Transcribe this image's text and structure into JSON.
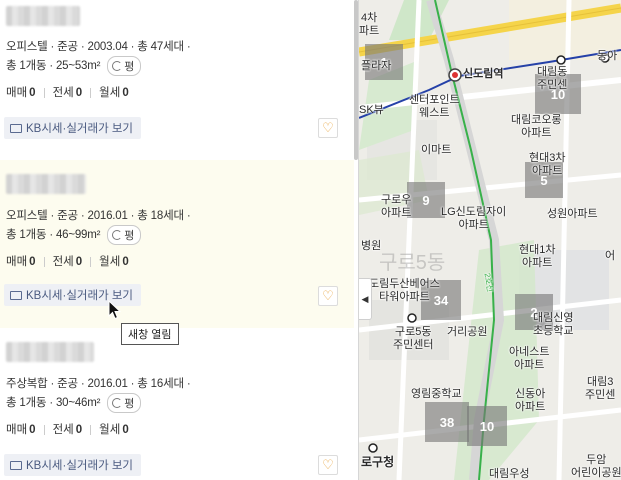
{
  "listings": [
    {
      "meta": "오피스텔 · 준공 · 2003.04 · 총 47세대 ·",
      "area": "총 1개동 · 25~53m²",
      "pyeong_label": "평",
      "prices": [
        {
          "label": "매매",
          "value": "0"
        },
        {
          "label": "전세",
          "value": "0"
        },
        {
          "label": "월세",
          "value": "0"
        }
      ],
      "kb_button": "KB시세·실거래가 보기"
    },
    {
      "meta": "오피스텔 · 준공 · 2016.01 · 총 18세대 ·",
      "area": "총 1개동 · 46~99m²",
      "pyeong_label": "평",
      "prices": [
        {
          "label": "매매",
          "value": "0"
        },
        {
          "label": "전세",
          "value": "0"
        },
        {
          "label": "월세",
          "value": "0"
        }
      ],
      "kb_button": "KB시세·실거래가 보기"
    },
    {
      "meta": "주상복합 · 준공 · 2016.01 · 총 16세대 ·",
      "area": "총 1개동 · 30~46m²",
      "pyeong_label": "평",
      "prices": [
        {
          "label": "매매",
          "value": "0"
        },
        {
          "label": "전세",
          "value": "0"
        },
        {
          "label": "월세",
          "value": "0"
        }
      ],
      "kb_button": "KB시세·실거래가 보기"
    }
  ],
  "tooltip": "새창 열림",
  "icons": {
    "heart": "heart-icon",
    "refresh": "refresh-icon",
    "kb": "kb-monitor-icon",
    "cursor": "mouse-cursor-icon",
    "collapse": "chevron-left-icon"
  },
  "colors": {
    "highlight_bg": "#fdfcef",
    "kb_button_bg": "#eef0f5",
    "heart": "#e8a33c",
    "line2": "#38b14a",
    "line1": "#2541a8",
    "yellow_road": "#f5d44a"
  },
  "map": {
    "clusters": [
      "1",
      "10",
      "9",
      "5",
      "34",
      "2",
      "38",
      "10"
    ],
    "labels": {
      "building_top": "4차\n파트",
      "plaza": "플라자",
      "station": "신도림역",
      "center_point": "센터포인트\n웨스트",
      "k_view": "SK뷰",
      "emart": "이마트",
      "daerim_kolon": "대림코오롱\n아파트",
      "hyundai3": "현대3차\n아파트",
      "guro_u": "구로우\n아파트",
      "lg": "LG신도림자이\n아파트",
      "seongwon": "성원아파트",
      "hospital": "병원",
      "hyundai1": "현대1차\n아파트",
      "dorim_doosan": "도림두산베어스\n타워아파트",
      "daerim_sinyeong": "대림신영\n초등학교",
      "guro5_center": "구로5동\n주민센터",
      "geori_park": "거리공원",
      "anes": "아네스트\n아파트",
      "daerim_top": "대림동\n주민센",
      "yeongrim": "영림중학교",
      "sindonga": "신동아\n아파트",
      "daerim3": "대림3\n주민센",
      "gu_office": "로구청",
      "daerim_woosung": "대림우성",
      "duam": "두암\n어린이공원",
      "dong_right": "동아",
      "eo_right": "어",
      "dong_name": "구로5동",
      "line_label": "2호선"
    }
  }
}
